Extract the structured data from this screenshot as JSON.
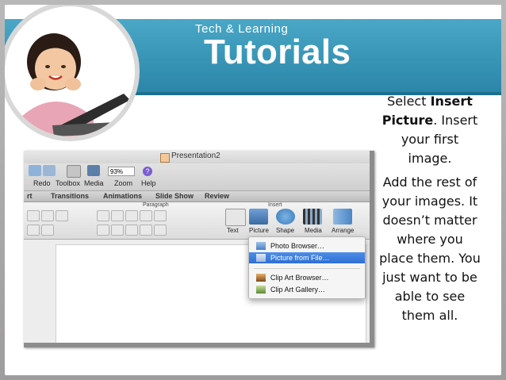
{
  "header": {
    "brand_small": "Tech & Learning",
    "brand_big": "Tutorials"
  },
  "instructions": {
    "p1_a": "Select ",
    "p1_bold": "Insert Picture",
    "p1_b": ".  Insert your first image.",
    "p2": "Add the rest of your images. It doesn’t matter where you place them. You just want to be able to see them all."
  },
  "app": {
    "doc_title": "Presentation2",
    "toolbar": {
      "redo": "Redo",
      "toolbox": "Toolbox",
      "media": "Media",
      "zoom": "Zoom",
      "help": "Help",
      "zoom_value": "93%"
    },
    "tabs": [
      "rt",
      "Transitions",
      "Animations",
      "Slide Show",
      "Review"
    ],
    "ribbon": {
      "paragraph": "Paragraph",
      "insert": "Insert",
      "text": "Text",
      "picture": "Picture",
      "shape": "Shape",
      "media": "Media",
      "arrange": "Arrange"
    },
    "picture_menu": {
      "items": [
        "Photo Browser…",
        "Picture from File…",
        "Clip Art Browser…",
        "Clip Art Gallery…"
      ],
      "selected": "Picture from File…"
    }
  },
  "colors": {
    "banner": "#2b86a9",
    "menu_highlight": "#2f6fd2"
  }
}
